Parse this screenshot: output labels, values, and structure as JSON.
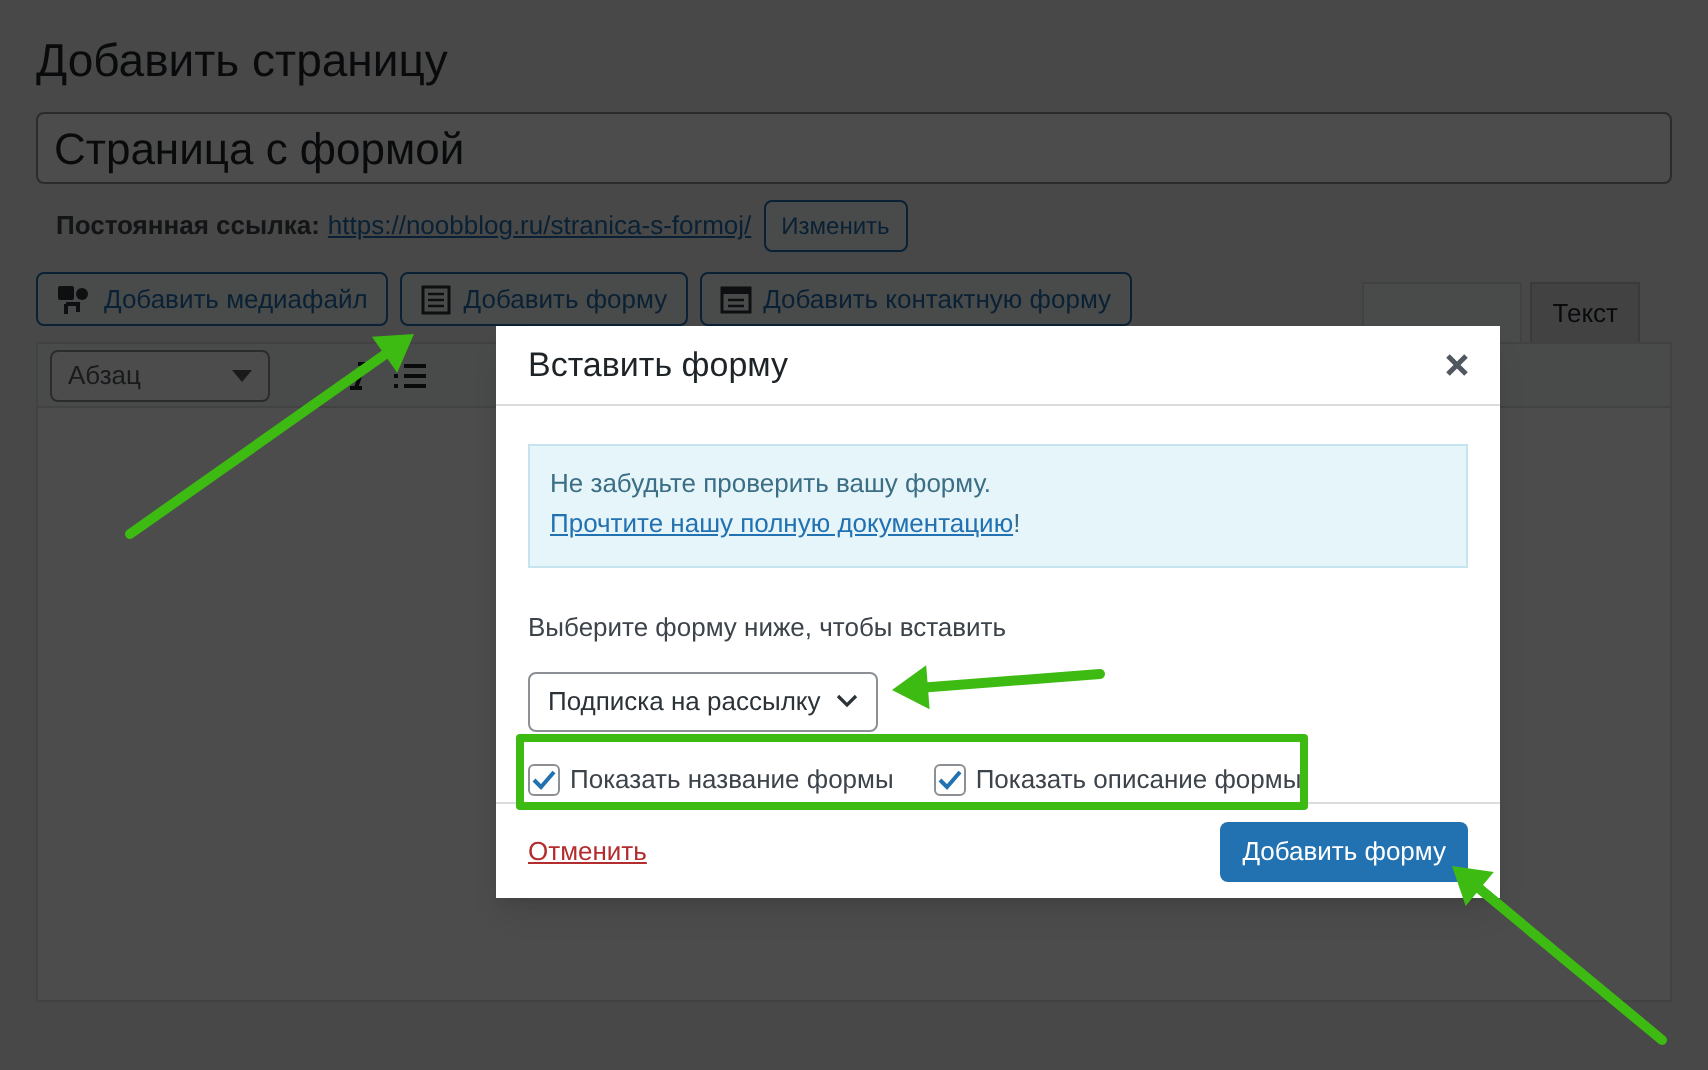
{
  "page": {
    "heading": "Добавить страницу",
    "title_field": {
      "value": "Страница с формой"
    },
    "permalink": {
      "label": "Постоянная ссылка:",
      "url": "https://noobblog.ru/stranica-s-formoj/",
      "button": "Изменить"
    },
    "media_buttons": [
      {
        "kind": "media",
        "label": "Добавить медиафайл"
      },
      {
        "kind": "form",
        "label": "Добавить форму"
      },
      {
        "kind": "contact",
        "label": "Добавить контактную форму"
      }
    ],
    "editor_tabs": [
      {
        "label": "Текст",
        "selected": false
      }
    ],
    "toolbar": {
      "format_select": "Абзац"
    }
  },
  "modal": {
    "title": "Вставить форму",
    "notice": {
      "text": "Не забудьте проверить вашу форму.",
      "link": "Прочтите нашу полную документацию",
      "suffix": "!"
    },
    "prompt": "Выберите форму ниже, чтобы вставить",
    "form_select": "Подписка на рассылку",
    "checkboxes": [
      {
        "label": "Показать название формы",
        "checked": true
      },
      {
        "label": "Показать описание формы",
        "checked": true
      }
    ],
    "cancel": "Отменить",
    "submit": "Добавить форму"
  }
}
